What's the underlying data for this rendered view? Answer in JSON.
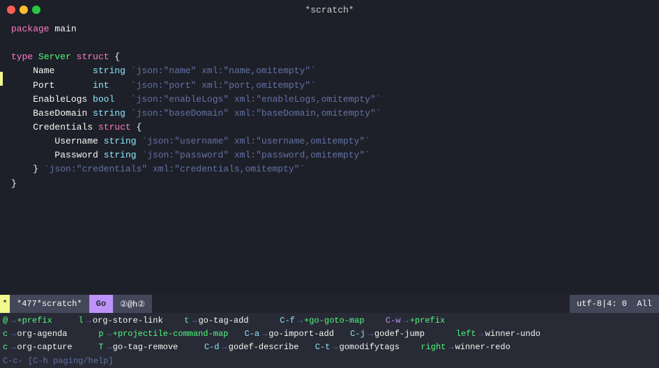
{
  "titleBar": {
    "title": "*scratch*"
  },
  "modeLine": {
    "indicator": "*",
    "lineCount": "477",
    "bufferName": "*scratch*",
    "mode": "Go",
    "unicodeMode": "②@h②",
    "encoding": "utf-8",
    "position": "4: 0",
    "allLabel": "All"
  },
  "code": {
    "packageLine": "package main",
    "lines": [
      "",
      "type Server struct {",
      "    Name       string `json:\"name\" xml:\"name,omitempty\"`",
      "    Port       int    `json:\"port\" xml:\"port,omitempty\"`",
      "    EnableLogs bool   `json:\"enableLogs\" xml:\"enableLogs,omitempty\"`",
      "    BaseDomain string `json:\"baseDomain\" xml:\"baseDomain,omitempty\"`",
      "    Credentials struct {",
      "        Username string `json:\"username\" xml:\"username,omitempty\"`",
      "        Password string `json:\"password\" xml:\"password,omitempty\"`",
      "    } `json:\"credentials\" xml:\"credentials,omitempty\"`",
      "}"
    ]
  },
  "hints": {
    "row1": [
      {
        "key": "@",
        "arrow": "→",
        "cmd": "+prefix"
      },
      {
        "key": "l",
        "arrow": "→",
        "cmd": "org-store-link"
      },
      {
        "key": "t",
        "arrow": "→",
        "cmd": "go-tag-add"
      },
      {
        "key": "C-f",
        "arrow": "→",
        "cmd": "+go-goto-map"
      },
      {
        "key": "C-w",
        "arrow": "→",
        "cmd": "+prefix"
      }
    ],
    "row2": [
      {
        "key": "c",
        "arrow": "→",
        "cmd": "org-agenda"
      },
      {
        "key": "p",
        "arrow": "→",
        "cmd": "+projectile-command-map"
      },
      {
        "key": "C-a",
        "arrow": "→",
        "cmd": "go-import-add"
      },
      {
        "key": "C-j",
        "arrow": "→",
        "cmd": "godef-jump"
      },
      {
        "key": "left",
        "arrow": "→",
        "cmd": "winner-undo"
      }
    ],
    "row3": [
      {
        "key": "c",
        "arrow": "→",
        "cmd": "org-capture"
      },
      {
        "key": "T",
        "arrow": "→",
        "cmd": "go-tag-remove"
      },
      {
        "key": "C-d",
        "arrow": "→",
        "cmd": "godef-describe"
      },
      {
        "key": "C-t",
        "arrow": "→",
        "cmd": "gomodifytags"
      },
      {
        "key": "right",
        "arrow": "→",
        "cmd": "winner-redo"
      }
    ],
    "row4": "C-c-  [C-h paging/help]"
  }
}
